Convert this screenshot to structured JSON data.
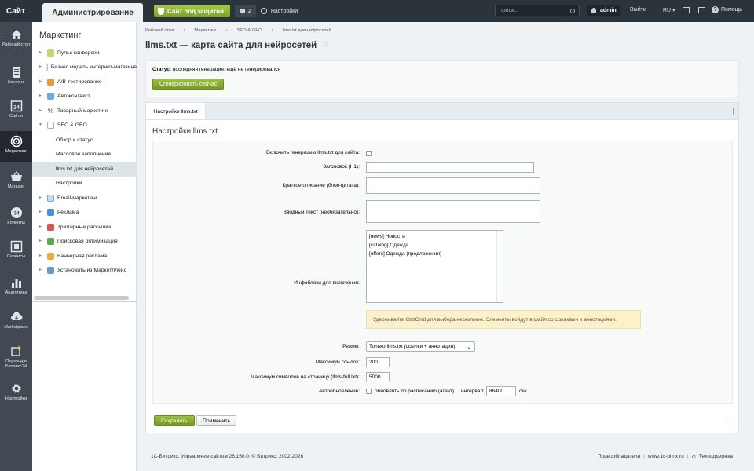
{
  "topbar": {
    "site_tab": "Сайт",
    "admin_tab": "Администрирование",
    "protection_button": "Сайт под защитой",
    "notifications_count": "2",
    "settings": "Настройки",
    "search_placeholder": "поиск...",
    "user": "admin",
    "logout": "Выйти",
    "lang": "RU",
    "help": "Помощь"
  },
  "rail": [
    {
      "label": "Рабочий стол",
      "icon": "home-icon"
    },
    {
      "label": "Контент",
      "icon": "document-icon"
    },
    {
      "label": "Сайты",
      "icon": "calendar-icon"
    },
    {
      "label": "Маркетинг",
      "icon": "target-icon"
    },
    {
      "label": "Магазин",
      "icon": "basket-icon"
    },
    {
      "label": "Клиенты",
      "icon": "clients-icon"
    },
    {
      "label": "Сервисы",
      "icon": "services-icon"
    },
    {
      "label": "Аналитика",
      "icon": "chart-icon"
    },
    {
      "label": "Marketplace",
      "icon": "cloud-icon"
    },
    {
      "label": "Переход в Битрикс24",
      "icon": "bitrix24-icon"
    },
    {
      "label": "Настройки",
      "icon": "gear-icon"
    }
  ],
  "sidebar": {
    "title": "Маркетинг",
    "items": [
      {
        "label": "Пульс конверсии"
      },
      {
        "label": "Бизнес модель интернет-магазина"
      },
      {
        "label": "A/B-тестирование"
      },
      {
        "label": "Автоконтекст"
      },
      {
        "label": "Товарный маркетинг"
      },
      {
        "label": "SEO & GEO"
      },
      {
        "label": "Обзор и статус"
      },
      {
        "label": "Массовое заполнение"
      },
      {
        "label": "llms.txt для нейросетей"
      },
      {
        "label": "Настройки"
      },
      {
        "label": "Email-маркетинг"
      },
      {
        "label": "Реклама"
      },
      {
        "label": "Триггерные рассылки"
      },
      {
        "label": "Поисковая оптимизация"
      },
      {
        "label": "Баннерная реклама"
      },
      {
        "label": "Установить из Маркетплейс"
      }
    ]
  },
  "breadcrumb": [
    "Рабочий стол",
    "Маркетинг",
    "SEO & GEO",
    "llms.txt для нейросетей"
  ],
  "page_title": "llms.txt — карта сайта для нейросетей",
  "status": {
    "label": "Статус:",
    "text": "последняя генерация: ещё не генерировался",
    "button": "Сгенерировать сейчас"
  },
  "tab": "Настройки llms.txt",
  "form": {
    "title": "Настройки llms.txt",
    "enable_label": "Включить генерацию llms.txt для сайта:",
    "h1_label": "Заголовок (H1):",
    "h1_value": "",
    "short_label": "Краткое описание (блок-цитата):",
    "intro_label": "Вводный текст (необязательно):",
    "iblocks_label": "Инфоблоки для включения:",
    "iblocks": [
      "[news] Новости",
      "[catalog] Одежда",
      "[offers] Одежда (предложения)"
    ],
    "hint": "Удерживайте Ctrl/Cmd для выбора нескольких. Элементы войдут в файл со ссылками и аннотациями.",
    "mode_label": "Режим:",
    "mode_value": "Только llms.txt (ссылки + аннотации)",
    "max_links_label": "Максимум ссылок:",
    "max_links_value": "200",
    "max_chars_label": "Максимум символов на страницу (llms-full.txt):",
    "max_chars_value": "5000",
    "auto_label": "Автообновление:",
    "auto_text": "обновлять по расписанию (агент)",
    "interval_label": "интервал:",
    "interval_value": "86400",
    "interval_unit": "сек."
  },
  "buttons": {
    "save": "Сохранить",
    "apply": "Применить"
  },
  "footer": {
    "left": "1С-Битрикс: Управление сайтом 26.150.0. © Битрикс, 2002-2026",
    "rights": "Правообладатели",
    "site": "www.1c-bitrix.ru",
    "support": "Техподдержка"
  }
}
